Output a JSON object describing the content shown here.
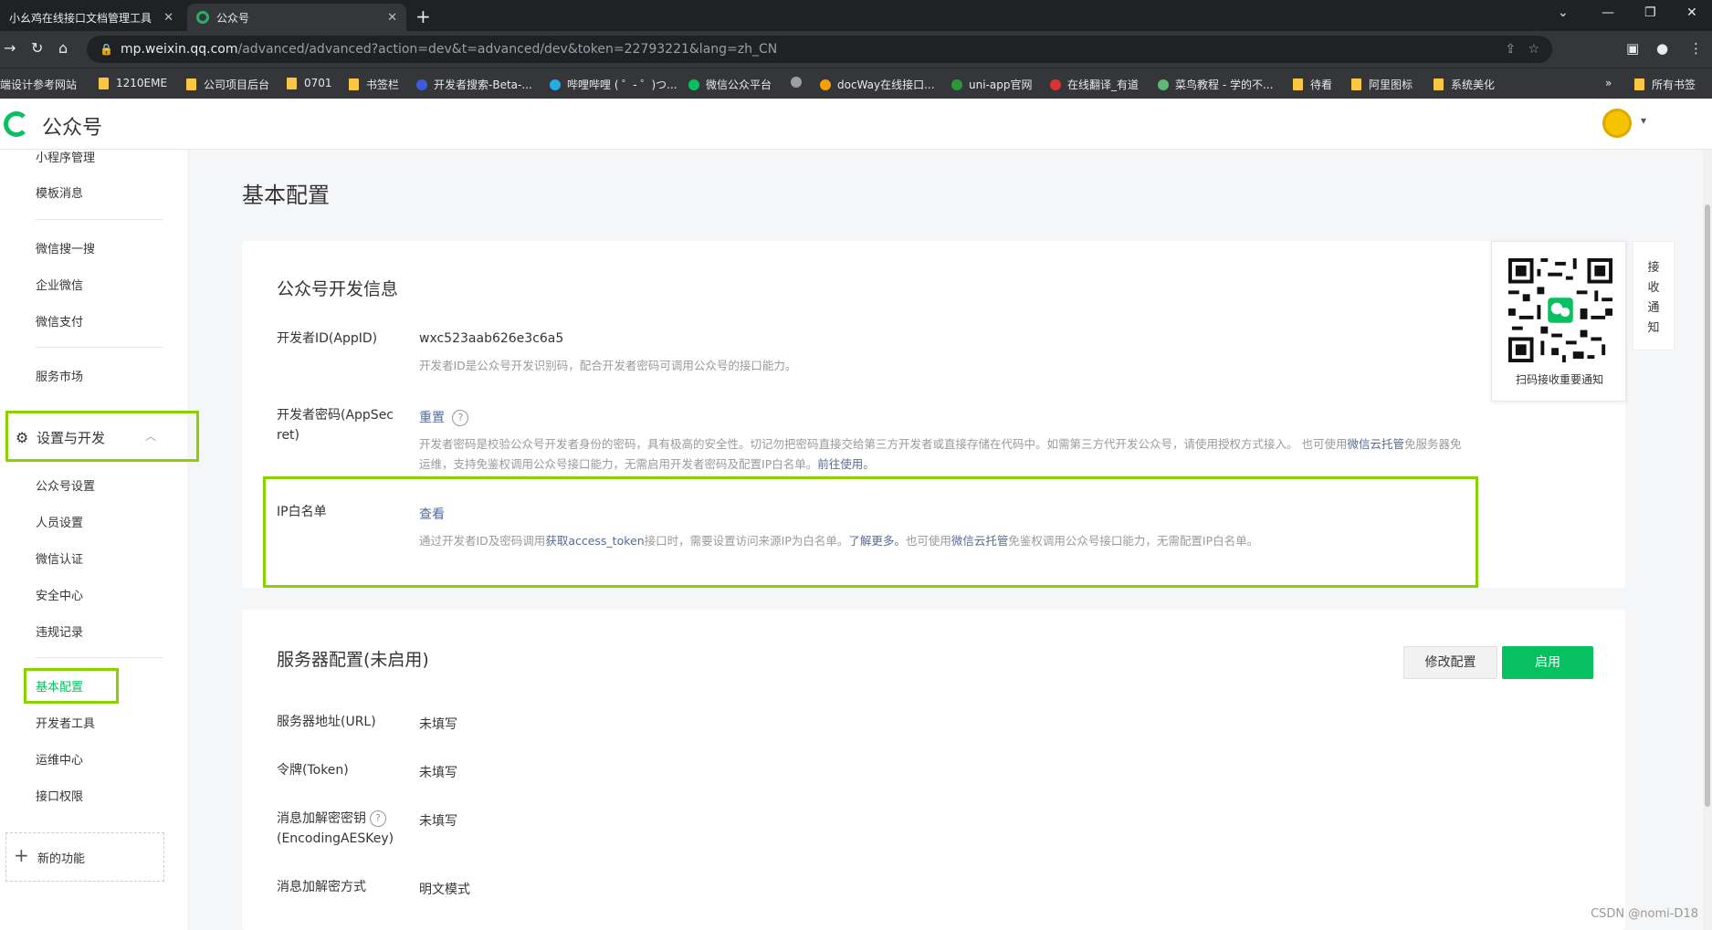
{
  "browser": {
    "tabs": [
      {
        "title": "小幺鸡在线接口文档管理工具",
        "active": false
      },
      {
        "title": "公众号",
        "active": true
      }
    ],
    "url_host": "mp.weixin.qq.com",
    "url_path": "/advanced/advanced?action=dev&t=advanced/dev&token=22793221&lang=zh_CN",
    "bookmarks": [
      {
        "label": "端设计参考网站",
        "icon": "folder"
      },
      {
        "label": "1210EME",
        "icon": "folder"
      },
      {
        "label": "公司项目后台",
        "icon": "folder"
      },
      {
        "label": "0701",
        "icon": "folder"
      },
      {
        "label": "书签栏",
        "icon": "folder"
      },
      {
        "label": "开发者搜索-Beta-...",
        "icon": "baidu",
        "color": "#3b5bdb"
      },
      {
        "label": "哔哩哔哩 ( ゜- ゜)つ...",
        "icon": "bilibili",
        "color": "#23ade5"
      },
      {
        "label": "微信公众平台",
        "icon": "wechat",
        "color": "#07c160"
      },
      {
        "label": "",
        "icon": "globe",
        "color": "#9aa0a6"
      },
      {
        "label": "docWay在线接口...",
        "icon": "docway",
        "color": "#f59f00"
      },
      {
        "label": "uni-app官网",
        "icon": "uniapp",
        "color": "#2b9939"
      },
      {
        "label": "在线翻译_有道",
        "icon": "youdao",
        "color": "#e03131"
      },
      {
        "label": "菜鸟教程 - 学的不...",
        "icon": "runoob",
        "color": "#5fb878"
      },
      {
        "label": "待看",
        "icon": "folder"
      },
      {
        "label": "阿里图标",
        "icon": "folder"
      },
      {
        "label": "系统美化",
        "icon": "folder"
      }
    ],
    "more": "»",
    "all_bookmarks": "所有书签"
  },
  "header": {
    "logo_text": "公众号"
  },
  "sidebar": {
    "top_items": [
      {
        "label": "小程序管理"
      },
      {
        "label": "模板消息"
      },
      {
        "label": "微信搜一搜"
      },
      {
        "label": "企业微信"
      },
      {
        "label": "微信支付"
      },
      {
        "label": "服务市场"
      }
    ],
    "group_label": "设置与开发",
    "group_items": [
      {
        "label": "公众号设置"
      },
      {
        "label": "人员设置"
      },
      {
        "label": "微信认证"
      },
      {
        "label": "安全中心"
      },
      {
        "label": "违规记录"
      },
      {
        "label": "基本配置",
        "active": true
      },
      {
        "label": "开发者工具"
      },
      {
        "label": "运维中心"
      },
      {
        "label": "接口权限"
      }
    ],
    "new_feature": "新的功能"
  },
  "page": {
    "title": "基本配置"
  },
  "dev_info": {
    "title": "公众号开发信息",
    "appid_label": "开发者ID(AppID)",
    "appid_value": "wxc523aab626e3c6a5",
    "appid_tip": "开发者ID是公众号开发识别码，配合开发者密码可调用公众号的接口能力。",
    "secret_label_1": "开发者密码(AppSec",
    "secret_label_2": "ret)",
    "secret_action": "重置",
    "secret_tip_1a": "开发者密码是校验公众号开发者身份的密码，具有极高的安全性。切记勿把密码直接交给第三方开发者或直接存储在代码中。如需第三方代开发公众号，请使用授权方式接入。 也可使用",
    "secret_tip_1b": "微信云托管",
    "secret_tip_1c": "免服务器免",
    "secret_tip_2a": "运维，支持免鉴权调用公众号接口能力，无需启用开发者密码及配置IP白名单。",
    "secret_tip_2b": "前往使用。",
    "ip_label": "IP白名单",
    "ip_action": "查看",
    "ip_tip_a": "通过开发者ID及密码调用",
    "ip_tip_b": "获取access_token",
    "ip_tip_c": "接口时，需要设置访问来源IP为白名单。",
    "ip_tip_d": "了解更多。",
    "ip_tip_e": "也可使用",
    "ip_tip_f": "微信云托管",
    "ip_tip_g": "免鉴权调用公众号接口能力，无需配置IP白名单。"
  },
  "qr": {
    "caption": "扫码接收重要通知",
    "side_tab": [
      "接",
      "收",
      "通",
      "知"
    ]
  },
  "server": {
    "title": "服务器配置(未启用)",
    "edit_button": "修改配置",
    "enable_button": "启用",
    "rows": [
      {
        "label": "服务器地址(URL)",
        "value": "未填写"
      },
      {
        "label": "令牌(Token)",
        "value": "未填写"
      },
      {
        "label": "消息加解密密钥",
        "label2": "(EncodingAESKey)",
        "value": "未填写"
      },
      {
        "label": "消息加解密方式",
        "value": "明文模式"
      }
    ]
  },
  "watermark": "CSDN @nomi-D18",
  "colors": {
    "brand_green": "#07c160",
    "highlight_box": "#8bd100",
    "link": "#576b95"
  }
}
